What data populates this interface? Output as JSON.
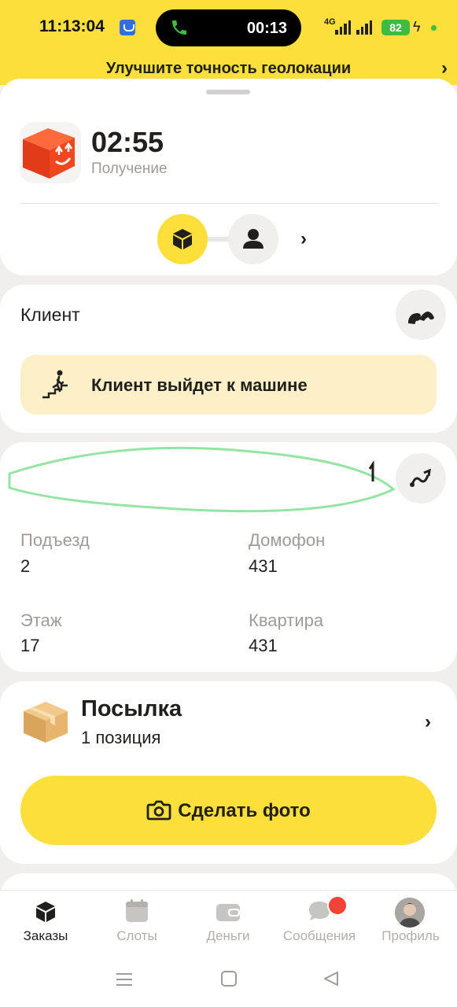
{
  "status_bar": {
    "time": "11:13:04",
    "call_duration": "00:13",
    "network": "4G",
    "battery": "82"
  },
  "geo_banner": {
    "text": "Улучшите точность геолокации"
  },
  "order": {
    "timer": "02:55",
    "phase": "Получение"
  },
  "client": {
    "label": "Клиент",
    "notice": "Клиент выйдет к машине"
  },
  "address": {
    "fields": [
      {
        "label": "Подъезд",
        "value": "2"
      },
      {
        "label": "Домофон",
        "value": "431"
      },
      {
        "label": "Этаж",
        "value": "17"
      },
      {
        "label": "Квартира",
        "value": "431"
      }
    ]
  },
  "parcel": {
    "title": "Посылка",
    "subtitle": "1 позиция",
    "photo_button": "Сделать фото"
  },
  "bottom_nav": {
    "items": [
      {
        "label": "Заказы",
        "icon": "orders-icon"
      },
      {
        "label": "Слоты",
        "icon": "calendar-icon"
      },
      {
        "label": "Деньги",
        "icon": "wallet-icon"
      },
      {
        "label": "Сообщения",
        "icon": "chat-icon"
      },
      {
        "label": "Профиль",
        "icon": "avatar"
      }
    ]
  },
  "colors": {
    "accent": "#fcdf3a",
    "notice_bg": "#fdf0c8",
    "badge": "#f44336"
  }
}
